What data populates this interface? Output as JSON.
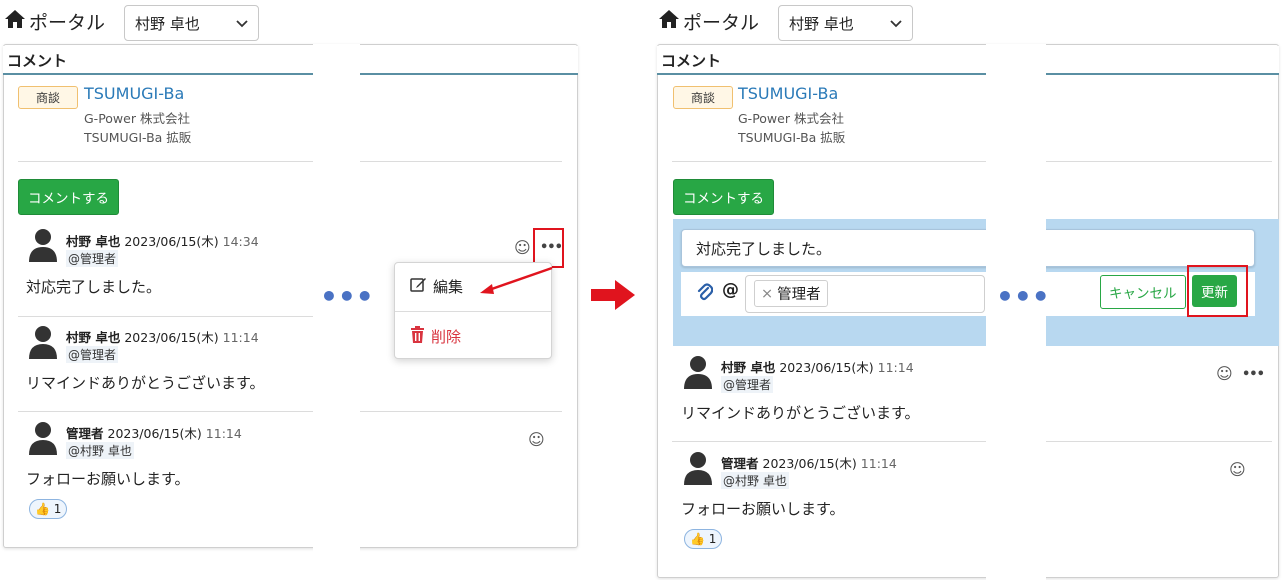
{
  "portal": {
    "title": "ポータル",
    "user": "村野 卓也"
  },
  "section": {
    "title": "コメント"
  },
  "deal": {
    "badge": "商談",
    "title": "TSUMUGI-Ba",
    "company": "G-Power 株式会社",
    "project": "TSUMUGI-Ba 拡販"
  },
  "comment_button": "コメントする",
  "comments": [
    {
      "author": "村野 卓也",
      "date": "2023/06/15(木)",
      "time": "14:34",
      "mention": "@管理者",
      "body": "対応完了しました。"
    },
    {
      "author": "村野 卓也",
      "date": "2023/06/15(木)",
      "time": "11:14",
      "mention": "@管理者",
      "body": "リマインドありがとうございます。"
    },
    {
      "author": "管理者",
      "date": "2023/06/15(木)",
      "time": "11:14",
      "mention": "@村野 卓也",
      "body": "フォローお願いします。",
      "reaction_count": "1"
    }
  ],
  "menu": {
    "edit": "編集",
    "delete": "削除"
  },
  "editor": {
    "value": "対応完了しました。",
    "mention_tag": "管理者",
    "cancel": "キャンセル",
    "update": "更新"
  },
  "colors": {
    "accent_green": "#28a745",
    "highlight_red": "#e0141e",
    "link_blue": "#2a7ab8",
    "delete_red": "#d9343f"
  }
}
